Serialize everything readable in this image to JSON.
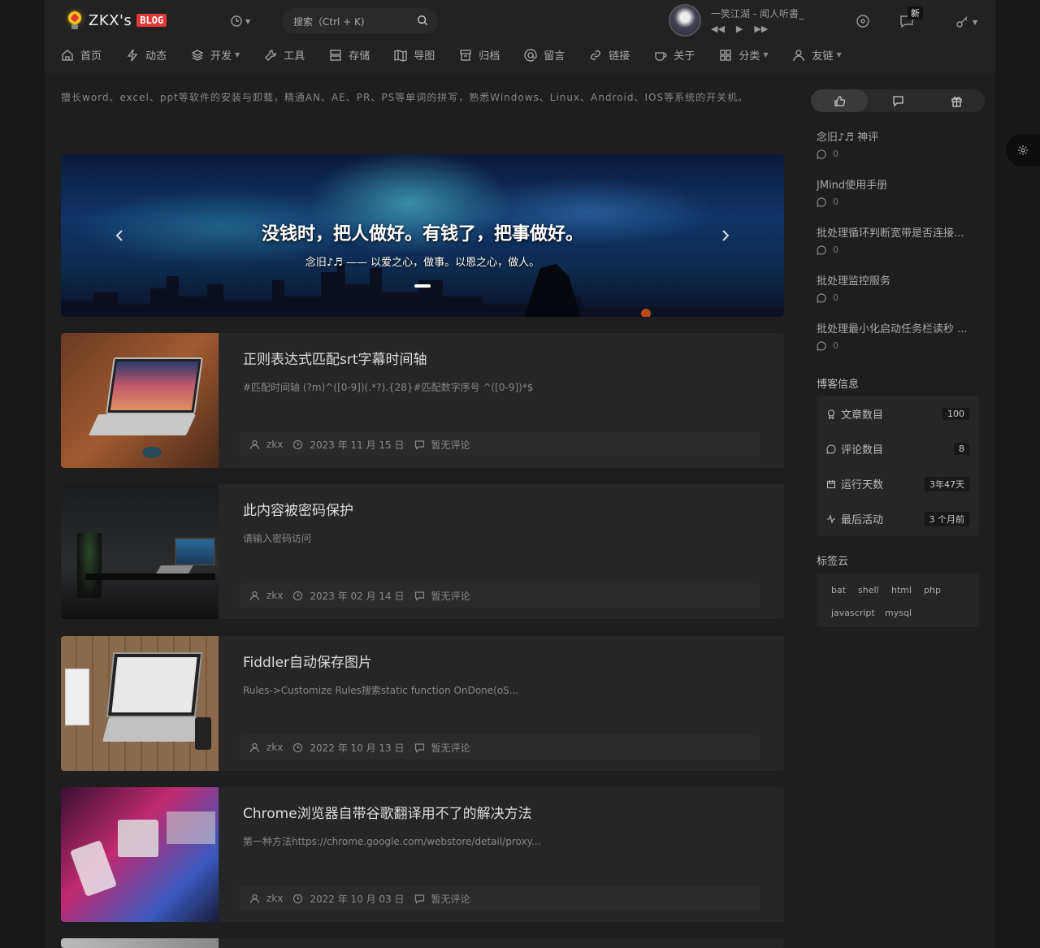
{
  "header": {
    "logo_text": "ZKX's",
    "logo_badge": "BLOG",
    "search_placeholder": "搜索（Ctrl + K)",
    "song": "一笑江湖 - 闻人听書_",
    "new_badge": "新"
  },
  "nav": [
    {
      "label": "首页",
      "icon": "home-icon"
    },
    {
      "label": "动态",
      "icon": "lightning-icon"
    },
    {
      "label": "开发",
      "icon": "layers-icon",
      "dropdown": true
    },
    {
      "label": "工具",
      "icon": "wrench-icon"
    },
    {
      "label": "存储",
      "icon": "server-icon"
    },
    {
      "label": "导图",
      "icon": "map-icon"
    },
    {
      "label": "归档",
      "icon": "archive-icon"
    },
    {
      "label": "留言",
      "icon": "at-icon"
    },
    {
      "label": "链接",
      "icon": "link-icon"
    },
    {
      "label": "关于",
      "icon": "coffee-icon"
    },
    {
      "label": "分类",
      "icon": "grid-icon",
      "dropdown": true
    },
    {
      "label": "友链",
      "icon": "user-icon",
      "dropdown": true
    }
  ],
  "intro": "擅长word、excel、ppt等软件的安装与卸载，精通AN、AE、PR、PS等单词的拼写，熟悉Windows、Linux、Android、IOS等系统的开关机。",
  "banner": {
    "title": "没钱时，把人做好。有钱了，把事做好。",
    "subtitle": "念旧♪♬ —— 以爱之心，做事。以恩之心，做人。"
  },
  "posts": [
    {
      "title": "正则表达式匹配srt字幕时间轴",
      "excerpt": "#匹配时间轴 (?m)^([0-9])(.*?).{28}#匹配数字序号 ^([0-9])*$",
      "author": "zkx",
      "date": "2023 年 11 月 15 日",
      "comments": "暂无评论"
    },
    {
      "title": "此内容被密码保护",
      "excerpt": "请输入密码访问",
      "author": "zkx",
      "date": "2023 年 02 月 14 日",
      "comments": "暂无评论"
    },
    {
      "title": "Fiddler自动保存图片",
      "excerpt": "Rules->Customize Rules搜索static function OnDone(oS...",
      "author": "zkx",
      "date": "2022 年 10 月 13 日",
      "comments": "暂无评论"
    },
    {
      "title": "Chrome浏览器自带谷歌翻译用不了的解决方法",
      "excerpt": "第一种方法https://chrome.google.com/webstore/detail/proxy...",
      "author": "zkx",
      "date": "2022 年 10 月 03 日",
      "comments": "暂无评论"
    }
  ],
  "sidebar": {
    "comments": [
      {
        "title": "念旧♪♬ 神评",
        "count": "0"
      },
      {
        "title": "JMind使用手册",
        "count": "0"
      },
      {
        "title": "批处理循环判断宽带是否连接...",
        "count": "0"
      },
      {
        "title": "批处理监控服务",
        "count": "0"
      },
      {
        "title": "批处理最小化启动任务栏读秒 ...",
        "count": "0"
      }
    ],
    "info_heading": "博客信息",
    "info": [
      {
        "label": "文章数目",
        "value": "100"
      },
      {
        "label": "评论数目",
        "value": "8"
      },
      {
        "label": "运行天数",
        "value": "3年47天"
      },
      {
        "label": "最后活动",
        "value": "3 个月前"
      }
    ],
    "tags_heading": "标签云",
    "tags": [
      "bat",
      "shell",
      "html",
      "php",
      "javascript",
      "mysql"
    ]
  }
}
